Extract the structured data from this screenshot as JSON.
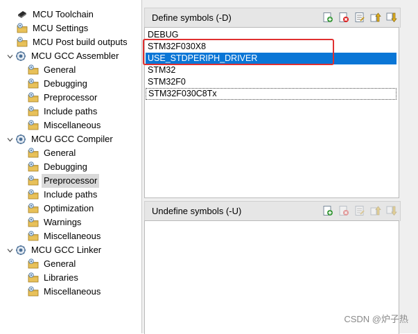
{
  "tree": {
    "items": [
      {
        "label": "MCU Toolchain",
        "icon": "chip-icon",
        "expand": ""
      },
      {
        "label": "MCU Settings",
        "icon": "settings-folder-icon",
        "expand": ""
      },
      {
        "label": "MCU Post build outputs",
        "icon": "settings-folder-icon",
        "expand": ""
      },
      {
        "label": "MCU GCC Assembler",
        "icon": "tool-gear-icon",
        "expand": "expanded"
      },
      {
        "label": "General",
        "icon": "settings-folder-icon",
        "expand": ""
      },
      {
        "label": "Debugging",
        "icon": "settings-folder-icon",
        "expand": ""
      },
      {
        "label": "Preprocessor",
        "icon": "settings-folder-icon",
        "expand": ""
      },
      {
        "label": "Include paths",
        "icon": "settings-folder-icon",
        "expand": ""
      },
      {
        "label": "Miscellaneous",
        "icon": "settings-folder-icon",
        "expand": ""
      },
      {
        "label": "MCU GCC Compiler",
        "icon": "tool-gear-icon",
        "expand": "expanded"
      },
      {
        "label": "General",
        "icon": "settings-folder-icon",
        "expand": ""
      },
      {
        "label": "Debugging",
        "icon": "settings-folder-icon",
        "expand": ""
      },
      {
        "label": "Preprocessor",
        "icon": "settings-folder-icon",
        "expand": "",
        "selected": true
      },
      {
        "label": "Include paths",
        "icon": "settings-folder-icon",
        "expand": ""
      },
      {
        "label": "Optimization",
        "icon": "settings-folder-icon",
        "expand": ""
      },
      {
        "label": "Warnings",
        "icon": "settings-folder-icon",
        "expand": ""
      },
      {
        "label": "Miscellaneous",
        "icon": "settings-folder-icon",
        "expand": ""
      },
      {
        "label": "MCU GCC Linker",
        "icon": "tool-gear-icon",
        "expand": "expanded"
      },
      {
        "label": "General",
        "icon": "settings-folder-icon",
        "expand": ""
      },
      {
        "label": "Libraries",
        "icon": "settings-folder-icon",
        "expand": ""
      },
      {
        "label": "Miscellaneous",
        "icon": "settings-folder-icon",
        "expand": ""
      }
    ]
  },
  "define": {
    "title": "Define symbols (-D)",
    "toolbar": [
      {
        "icon": "add-icon",
        "enabled": true
      },
      {
        "icon": "delete-icon",
        "enabled": true
      },
      {
        "icon": "edit-icon",
        "enabled": true
      },
      {
        "icon": "move-up-icon",
        "enabled": true
      },
      {
        "icon": "move-down-icon",
        "enabled": true
      }
    ],
    "items": [
      {
        "text": "DEBUG"
      },
      {
        "text": "STM32F030X8"
      },
      {
        "text": "USE_STDPERIPH_DRIVER",
        "selected": true
      },
      {
        "text": "STM32"
      },
      {
        "text": "STM32F0"
      },
      {
        "text": "STM32F030C8Tx",
        "focused": true
      }
    ]
  },
  "undefine": {
    "title": "Undefine symbols (-U)",
    "toolbar": [
      {
        "icon": "add-icon",
        "enabled": true
      },
      {
        "icon": "delete-icon",
        "enabled": false
      },
      {
        "icon": "edit-icon",
        "enabled": false
      },
      {
        "icon": "move-up-icon",
        "enabled": false
      },
      {
        "icon": "move-down-icon",
        "enabled": false
      }
    ],
    "items": []
  },
  "annotation": {
    "color": "#e03030"
  },
  "watermark": "CSDN @炉子热",
  "colors": {
    "selection": "#0a76d6",
    "tree_selection": "#d9d9d9"
  }
}
